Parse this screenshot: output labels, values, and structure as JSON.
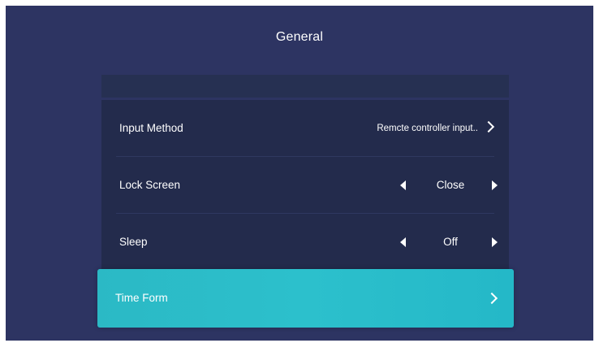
{
  "header": {
    "title": "General"
  },
  "settings": {
    "input_method": {
      "label": "Input Method",
      "value": "Remcte controller input.."
    },
    "lock_screen": {
      "label": "Lock Screen",
      "value": "Close"
    },
    "sleep": {
      "label": "Sleep",
      "value": "Off"
    },
    "time_form": {
      "label": "Time Form",
      "selected": true
    }
  },
  "icons": {
    "next": "chevron-right-icon",
    "decrease": "triangle-left-icon",
    "increase": "triangle-right-icon"
  },
  "colors": {
    "background": "#2d3462",
    "row": "#232b4c",
    "selected": "#2bb9c5",
    "text": "#ffffff"
  }
}
